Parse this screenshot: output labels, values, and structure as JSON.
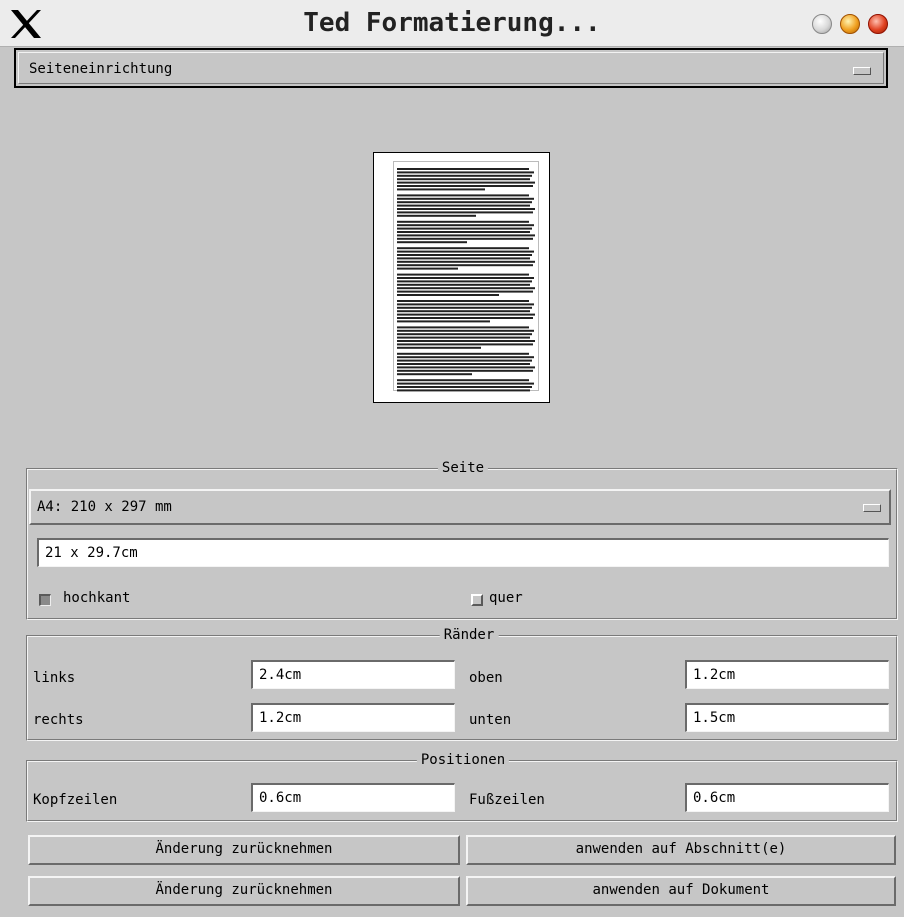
{
  "window": {
    "title": "Ted Formatierung...",
    "icons": [
      "x-logo-icon",
      "minimize-icon",
      "maximize-icon",
      "close-icon"
    ]
  },
  "top_dropdown": {
    "selected": "Seiteneinrichtung"
  },
  "page_group": {
    "title": "Seite",
    "size_dropdown": "A4: 210 x 297 mm",
    "size_field": "21 x 29.7cm",
    "portrait": {
      "label": "hochkant",
      "checked": true
    },
    "landscape": {
      "label": "quer",
      "checked": false
    }
  },
  "margins_group": {
    "title": "Ränder",
    "left": {
      "label": "links",
      "value": "2.4cm"
    },
    "top": {
      "label": "oben",
      "value": "1.2cm"
    },
    "right": {
      "label": "rechts",
      "value": "1.2cm"
    },
    "bottom": {
      "label": "unten",
      "value": "1.5cm"
    }
  },
  "positions_group": {
    "title": "Positionen",
    "header": {
      "label": "Kopfzeilen",
      "value": "0.6cm"
    },
    "footer": {
      "label": "Fußzeilen",
      "value": "0.6cm"
    }
  },
  "buttons": {
    "revert_1": "Änderung zurücknehmen",
    "apply_section": "anwenden auf Abschnitt(e)",
    "revert_2": "Änderung zurücknehmen",
    "apply_document": "anwenden auf Dokument"
  }
}
